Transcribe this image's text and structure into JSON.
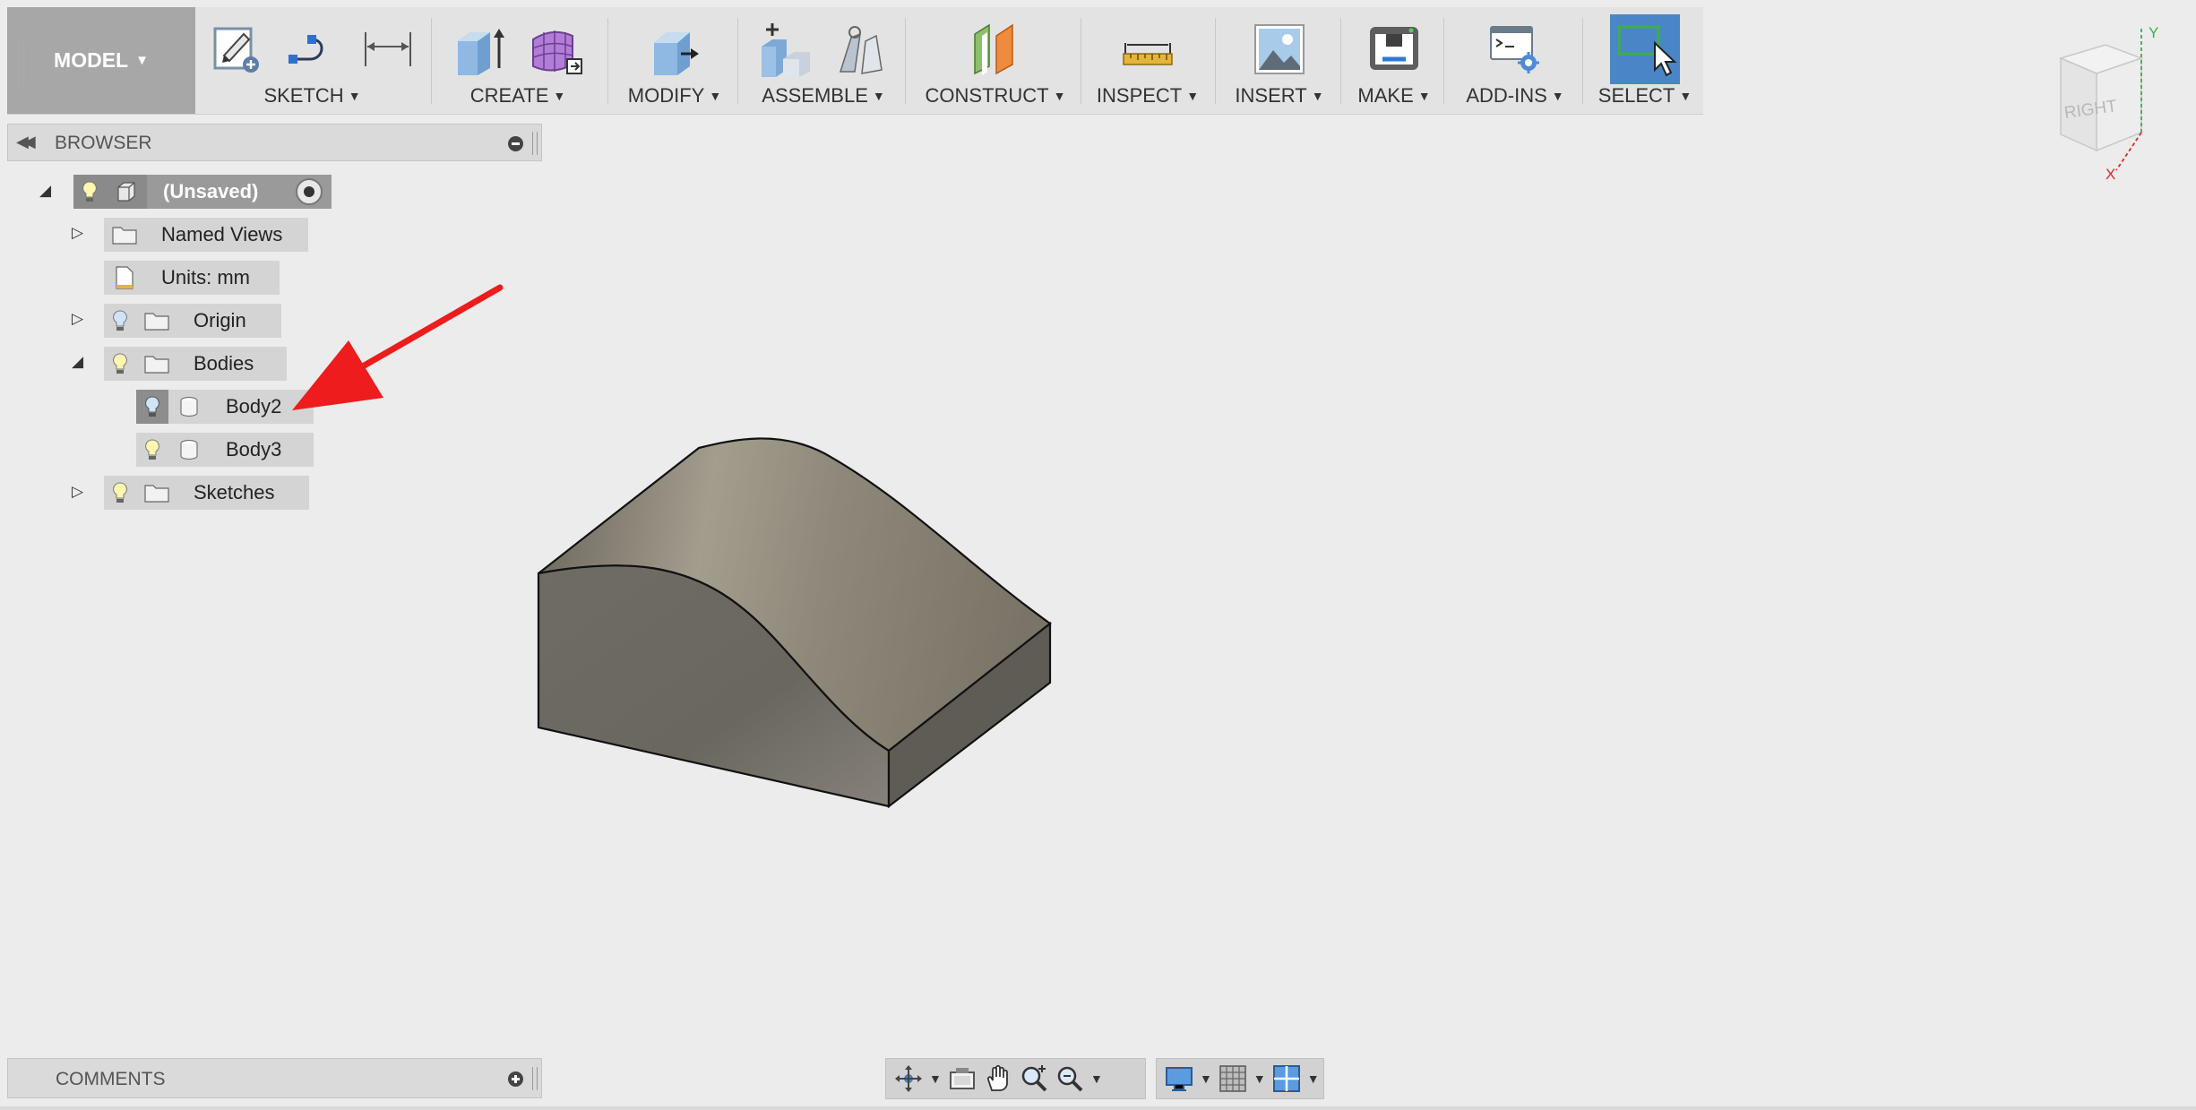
{
  "toolbar": {
    "workspace": "MODEL",
    "groups": {
      "sketch": "SKETCH",
      "create": "CREATE",
      "modify": "MODIFY",
      "assemble": "ASSEMBLE",
      "construct": "CONSTRUCT",
      "inspect": "INSPECT",
      "insert": "INSERT",
      "make": "MAKE",
      "addins": "ADD-INS",
      "select": "SELECT"
    }
  },
  "browser": {
    "title": "BROWSER",
    "root": "(Unsaved)",
    "items": {
      "named_views": "Named Views",
      "units": "Units: mm",
      "origin": "Origin",
      "bodies": "Bodies",
      "body2": "Body2",
      "body3": "Body3",
      "sketches": "Sketches"
    }
  },
  "viewcube": {
    "face": "RIGHT",
    "axis_y": "Y",
    "axis_x": "X"
  },
  "comments": {
    "title": "COMMENTS"
  },
  "colors": {
    "accent_select": "#4a86c7",
    "annotation_arrow": "#ee1c1c",
    "body_face_top": "#8f887a",
    "body_face_front": "#6c6a60",
    "body_face_side": "#5f5d55"
  }
}
